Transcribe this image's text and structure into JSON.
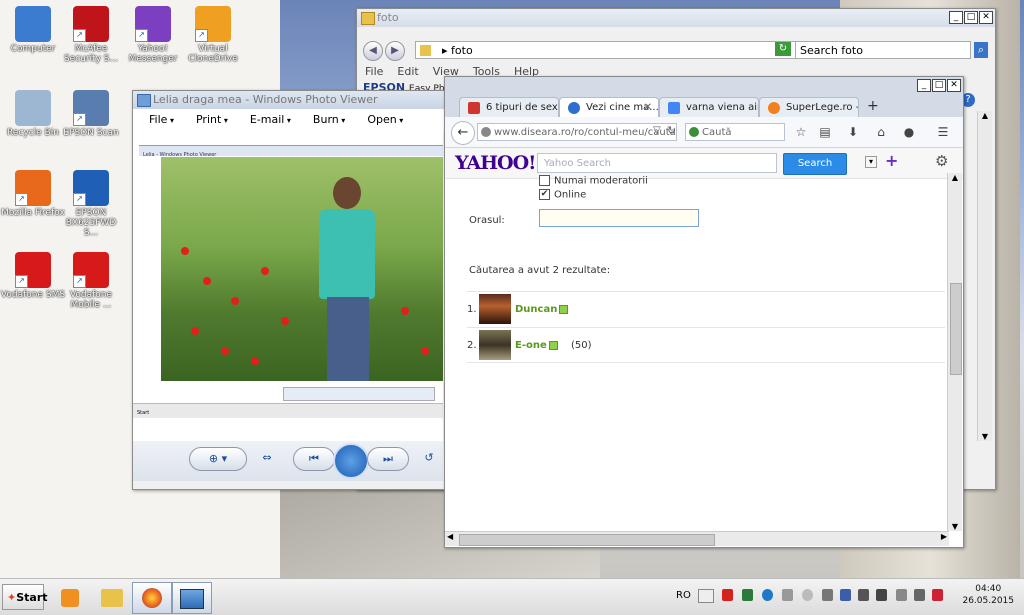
{
  "desktop": {
    "icons": [
      {
        "label": "Computer",
        "icon": "computer-icon",
        "color": "#3b7bd0"
      },
      {
        "label": "McAfee Security S...",
        "icon": "mcafee-icon",
        "color": "#c0141b"
      },
      {
        "label": "Yahoo! Messenger",
        "icon": "yahoo-messenger-icon",
        "color": "#7b3fbf"
      },
      {
        "label": "Virtual CloneDrive",
        "icon": "clonedrive-icon",
        "color": "#f0a020"
      },
      {
        "label": "Recycle Bin",
        "icon": "recycle-bin-icon",
        "color": "#9db7d3"
      },
      {
        "label": "EPSON Scan",
        "icon": "epson-scan-icon",
        "color": "#5a7db0"
      },
      {
        "label": "Mozilla Firefox",
        "icon": "firefox-icon",
        "color": "#e8681c"
      },
      {
        "label": "EPSON BX625FWD S...",
        "icon": "epson-printer-icon",
        "color": "#1f5fb5"
      },
      {
        "label": "Vodafone SMS",
        "icon": "vodafone-sms-icon",
        "color": "#d61a1a"
      },
      {
        "label": "Vodafone Mobile ...",
        "icon": "vodafone-mobile-icon",
        "color": "#d61a1a"
      }
    ]
  },
  "explorer": {
    "title": "foto",
    "path": "foto",
    "search_placeholder": "Search foto",
    "menu": [
      "File",
      "Edit",
      "View",
      "Tools",
      "Help"
    ],
    "epson_brand": "EPSON",
    "epson_sub": "Easy Pho"
  },
  "photo_viewer": {
    "title": "Lelia draga mea - Windows Photo Viewer",
    "menu": [
      "File",
      "Print",
      "E-mail",
      "Burn",
      "Open"
    ],
    "inner_title": "Lelia - Windows Photo Viewer",
    "inner_start": "Start"
  },
  "firefox": {
    "tabs": [
      {
        "label": "6 tipuri de sex ...",
        "color": "#d0352b"
      },
      {
        "label": "Vezi cine ma...",
        "color": "#2c6fd0"
      },
      {
        "label": "varna viena air...",
        "color": "#4285f4"
      },
      {
        "label": "SuperLege.ro - ...",
        "color": "#f08020"
      }
    ],
    "new_tab": "+",
    "url": "www.diseara.ro/ro/contul-meu/cautare...",
    "search_placeholder": "Caută",
    "yahoo": {
      "logo": "YAHOO!",
      "search_placeholder": "Yahoo Search",
      "search_button": "Search"
    },
    "page": {
      "option_moderators": "Numai moderatorii",
      "option_online": "Online",
      "online_checked": "✔",
      "city_label": "Orasul:",
      "results_text": "Căutarea a avut 2 rezultate:",
      "results": [
        {
          "num": "1.",
          "name": "Duncan",
          "extra": ""
        },
        {
          "num": "2.",
          "name": "E-one",
          "extra": "(50)"
        }
      ]
    }
  },
  "taskbar": {
    "start_label": "Start",
    "language": "RO",
    "time": "04:40",
    "date": "26.05.2015"
  }
}
